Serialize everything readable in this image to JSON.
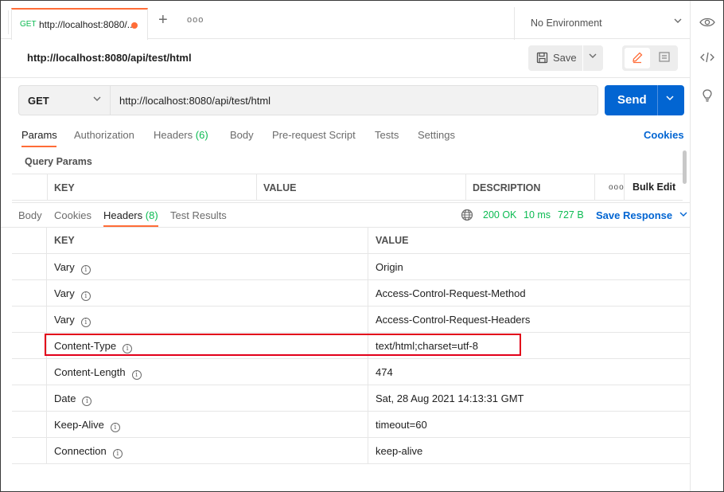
{
  "tab": {
    "method": "GET",
    "title": "http://localhost:8080/...",
    "new_tab_icon": "plus-icon",
    "more_icon": "more-horizontal-icon"
  },
  "environment": {
    "label": "No Environment"
  },
  "request": {
    "name": "http://localhost:8080/api/test/html",
    "method": "GET",
    "url": "http://localhost:8080/api/test/html",
    "save_label": "Save",
    "send_label": "Send"
  },
  "request_tabs": [
    {
      "label": "Params",
      "count": ""
    },
    {
      "label": "Authorization",
      "count": ""
    },
    {
      "label": "Headers",
      "count": "(6)"
    },
    {
      "label": "Body",
      "count": ""
    },
    {
      "label": "Pre-request Script",
      "count": ""
    },
    {
      "label": "Tests",
      "count": ""
    },
    {
      "label": "Settings",
      "count": ""
    }
  ],
  "cookies_link": "Cookies",
  "query_params": {
    "title": "Query Params",
    "columns": [
      "KEY",
      "VALUE",
      "DESCRIPTION"
    ],
    "bulk_edit": "Bulk Edit"
  },
  "response_tabs": [
    {
      "label": "Body",
      "count": ""
    },
    {
      "label": "Cookies",
      "count": ""
    },
    {
      "label": "Headers",
      "count": "(8)"
    },
    {
      "label": "Test Results",
      "count": ""
    }
  ],
  "response_status": {
    "status": "200 OK",
    "time": "10 ms",
    "size": "727 B",
    "save_response": "Save Response"
  },
  "response_headers": {
    "columns": [
      "KEY",
      "VALUE"
    ],
    "rows": [
      {
        "key": "Vary",
        "value": "Origin"
      },
      {
        "key": "Vary",
        "value": "Access-Control-Request-Method"
      },
      {
        "key": "Vary",
        "value": "Access-Control-Request-Headers"
      },
      {
        "key": "Content-Type",
        "value": "text/html;charset=utf-8"
      },
      {
        "key": "Content-Length",
        "value": "474"
      },
      {
        "key": "Date",
        "value": "Sat, 28 Aug 2021 14:13:31 GMT"
      },
      {
        "key": "Keep-Alive",
        "value": "timeout=60"
      },
      {
        "key": "Connection",
        "value": "keep-alive"
      }
    ]
  },
  "colors": {
    "accent": "#ff6c37",
    "primary": "#0265d2",
    "success": "#0cbb52",
    "highlight": "#e2001a"
  }
}
